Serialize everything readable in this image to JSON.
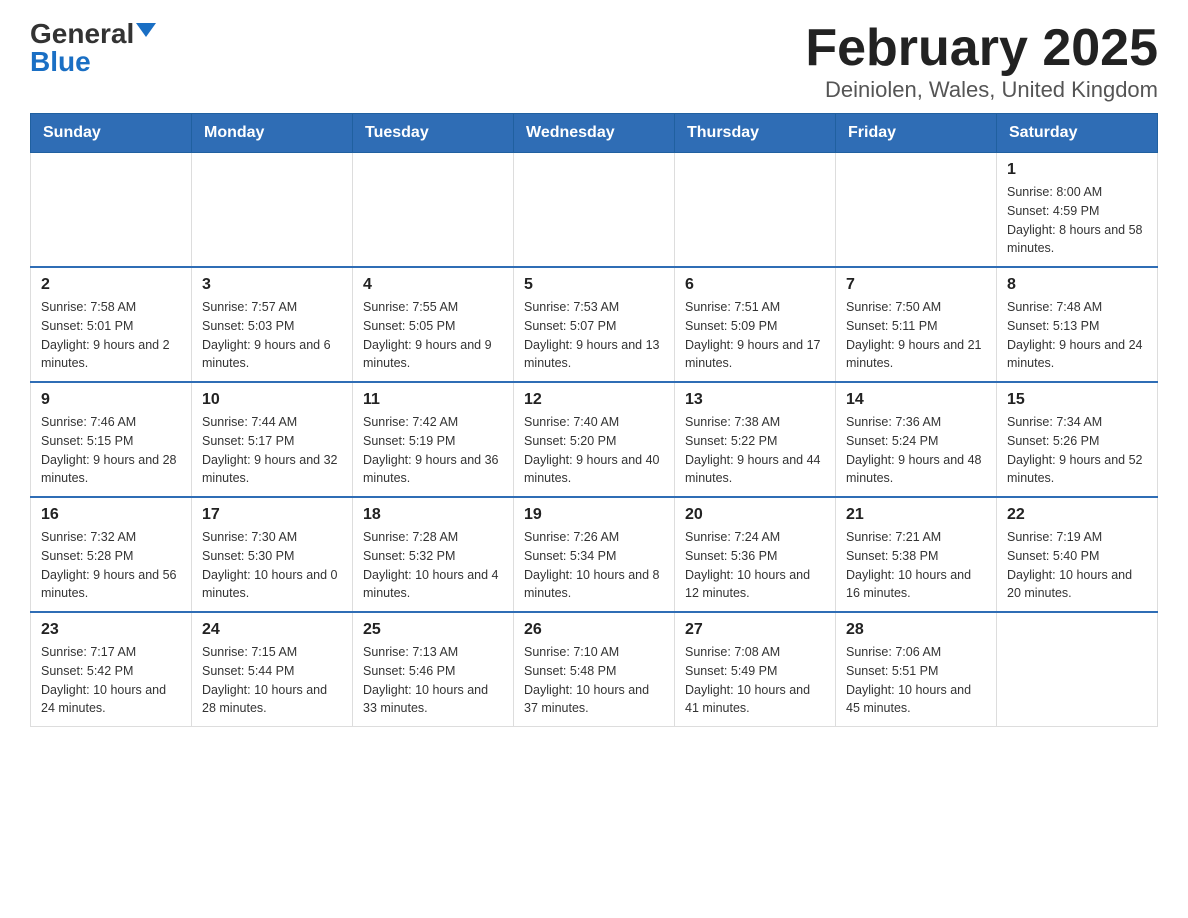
{
  "logo": {
    "general": "General",
    "blue": "Blue"
  },
  "title": "February 2025",
  "subtitle": "Deiniolen, Wales, United Kingdom",
  "days_of_week": [
    "Sunday",
    "Monday",
    "Tuesday",
    "Wednesday",
    "Thursday",
    "Friday",
    "Saturday"
  ],
  "weeks": [
    [
      {
        "day": "",
        "info": ""
      },
      {
        "day": "",
        "info": ""
      },
      {
        "day": "",
        "info": ""
      },
      {
        "day": "",
        "info": ""
      },
      {
        "day": "",
        "info": ""
      },
      {
        "day": "",
        "info": ""
      },
      {
        "day": "1",
        "info": "Sunrise: 8:00 AM\nSunset: 4:59 PM\nDaylight: 8 hours and 58 minutes."
      }
    ],
    [
      {
        "day": "2",
        "info": "Sunrise: 7:58 AM\nSunset: 5:01 PM\nDaylight: 9 hours and 2 minutes."
      },
      {
        "day": "3",
        "info": "Sunrise: 7:57 AM\nSunset: 5:03 PM\nDaylight: 9 hours and 6 minutes."
      },
      {
        "day": "4",
        "info": "Sunrise: 7:55 AM\nSunset: 5:05 PM\nDaylight: 9 hours and 9 minutes."
      },
      {
        "day": "5",
        "info": "Sunrise: 7:53 AM\nSunset: 5:07 PM\nDaylight: 9 hours and 13 minutes."
      },
      {
        "day": "6",
        "info": "Sunrise: 7:51 AM\nSunset: 5:09 PM\nDaylight: 9 hours and 17 minutes."
      },
      {
        "day": "7",
        "info": "Sunrise: 7:50 AM\nSunset: 5:11 PM\nDaylight: 9 hours and 21 minutes."
      },
      {
        "day": "8",
        "info": "Sunrise: 7:48 AM\nSunset: 5:13 PM\nDaylight: 9 hours and 24 minutes."
      }
    ],
    [
      {
        "day": "9",
        "info": "Sunrise: 7:46 AM\nSunset: 5:15 PM\nDaylight: 9 hours and 28 minutes."
      },
      {
        "day": "10",
        "info": "Sunrise: 7:44 AM\nSunset: 5:17 PM\nDaylight: 9 hours and 32 minutes."
      },
      {
        "day": "11",
        "info": "Sunrise: 7:42 AM\nSunset: 5:19 PM\nDaylight: 9 hours and 36 minutes."
      },
      {
        "day": "12",
        "info": "Sunrise: 7:40 AM\nSunset: 5:20 PM\nDaylight: 9 hours and 40 minutes."
      },
      {
        "day": "13",
        "info": "Sunrise: 7:38 AM\nSunset: 5:22 PM\nDaylight: 9 hours and 44 minutes."
      },
      {
        "day": "14",
        "info": "Sunrise: 7:36 AM\nSunset: 5:24 PM\nDaylight: 9 hours and 48 minutes."
      },
      {
        "day": "15",
        "info": "Sunrise: 7:34 AM\nSunset: 5:26 PM\nDaylight: 9 hours and 52 minutes."
      }
    ],
    [
      {
        "day": "16",
        "info": "Sunrise: 7:32 AM\nSunset: 5:28 PM\nDaylight: 9 hours and 56 minutes."
      },
      {
        "day": "17",
        "info": "Sunrise: 7:30 AM\nSunset: 5:30 PM\nDaylight: 10 hours and 0 minutes."
      },
      {
        "day": "18",
        "info": "Sunrise: 7:28 AM\nSunset: 5:32 PM\nDaylight: 10 hours and 4 minutes."
      },
      {
        "day": "19",
        "info": "Sunrise: 7:26 AM\nSunset: 5:34 PM\nDaylight: 10 hours and 8 minutes."
      },
      {
        "day": "20",
        "info": "Sunrise: 7:24 AM\nSunset: 5:36 PM\nDaylight: 10 hours and 12 minutes."
      },
      {
        "day": "21",
        "info": "Sunrise: 7:21 AM\nSunset: 5:38 PM\nDaylight: 10 hours and 16 minutes."
      },
      {
        "day": "22",
        "info": "Sunrise: 7:19 AM\nSunset: 5:40 PM\nDaylight: 10 hours and 20 minutes."
      }
    ],
    [
      {
        "day": "23",
        "info": "Sunrise: 7:17 AM\nSunset: 5:42 PM\nDaylight: 10 hours and 24 minutes."
      },
      {
        "day": "24",
        "info": "Sunrise: 7:15 AM\nSunset: 5:44 PM\nDaylight: 10 hours and 28 minutes."
      },
      {
        "day": "25",
        "info": "Sunrise: 7:13 AM\nSunset: 5:46 PM\nDaylight: 10 hours and 33 minutes."
      },
      {
        "day": "26",
        "info": "Sunrise: 7:10 AM\nSunset: 5:48 PM\nDaylight: 10 hours and 37 minutes."
      },
      {
        "day": "27",
        "info": "Sunrise: 7:08 AM\nSunset: 5:49 PM\nDaylight: 10 hours and 41 minutes."
      },
      {
        "day": "28",
        "info": "Sunrise: 7:06 AM\nSunset: 5:51 PM\nDaylight: 10 hours and 45 minutes."
      },
      {
        "day": "",
        "info": ""
      }
    ]
  ]
}
